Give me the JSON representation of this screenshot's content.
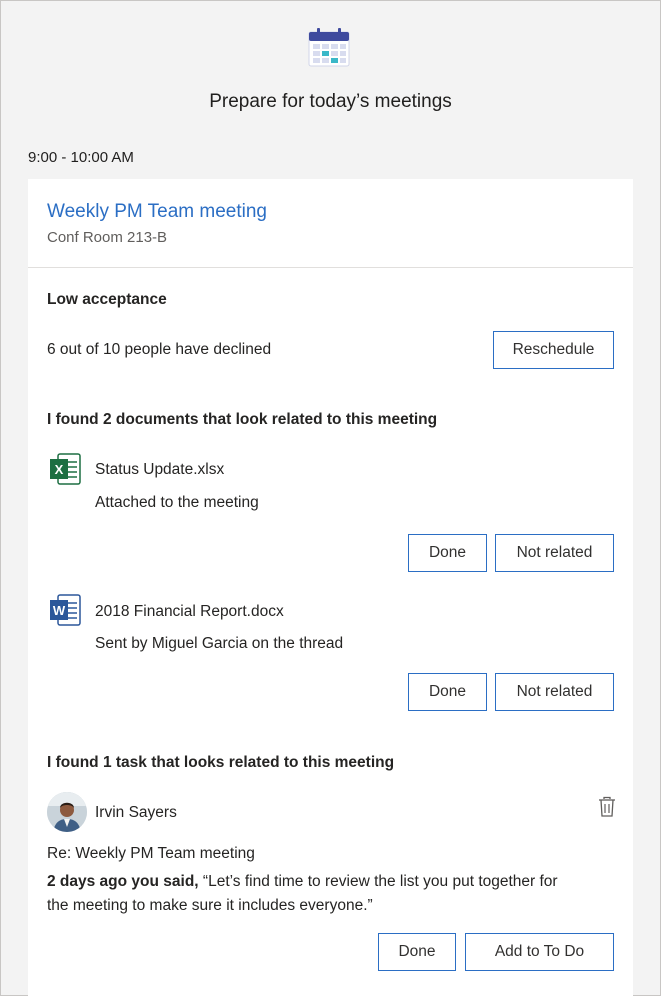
{
  "panel": {
    "heading": "Prepare for today’s meetings",
    "time_range": "9:00 - 10:00 AM"
  },
  "meeting": {
    "title": "Weekly PM Team meeting",
    "location": "Conf Room 213-B"
  },
  "acceptance": {
    "heading": "Low acceptance",
    "summary": "6 out of 10 people have declined",
    "reschedule_label": "Reschedule"
  },
  "documents": {
    "heading": "I found 2 documents that look related to this meeting",
    "items": [
      {
        "icon": "excel-file-icon",
        "name": "Status Update.xlsx",
        "detail": "Attached to the meeting",
        "done_label": "Done",
        "not_related_label": "Not related"
      },
      {
        "icon": "word-file-icon",
        "name": "2018 Financial Report.docx",
        "detail": "Sent by Miguel Garcia on the thread",
        "done_label": "Done",
        "not_related_label": "Not related"
      }
    ]
  },
  "task": {
    "heading": "I found 1 task that looks related to this meeting",
    "person": "Irvin Sayers",
    "subject": "Re: Weekly PM Team meeting",
    "when": "2 days ago you said,",
    "quote_line1": "“Let’s find time to review the list you put together for",
    "quote_line2": "the meeting to make sure it includes everyone.”",
    "done_label": "Done",
    "add_label": "Add to To Do"
  },
  "colors": {
    "accent": "#2b6ec4",
    "excel": "#1d6f42",
    "word": "#2b579a",
    "background": "#f3f3f3"
  }
}
